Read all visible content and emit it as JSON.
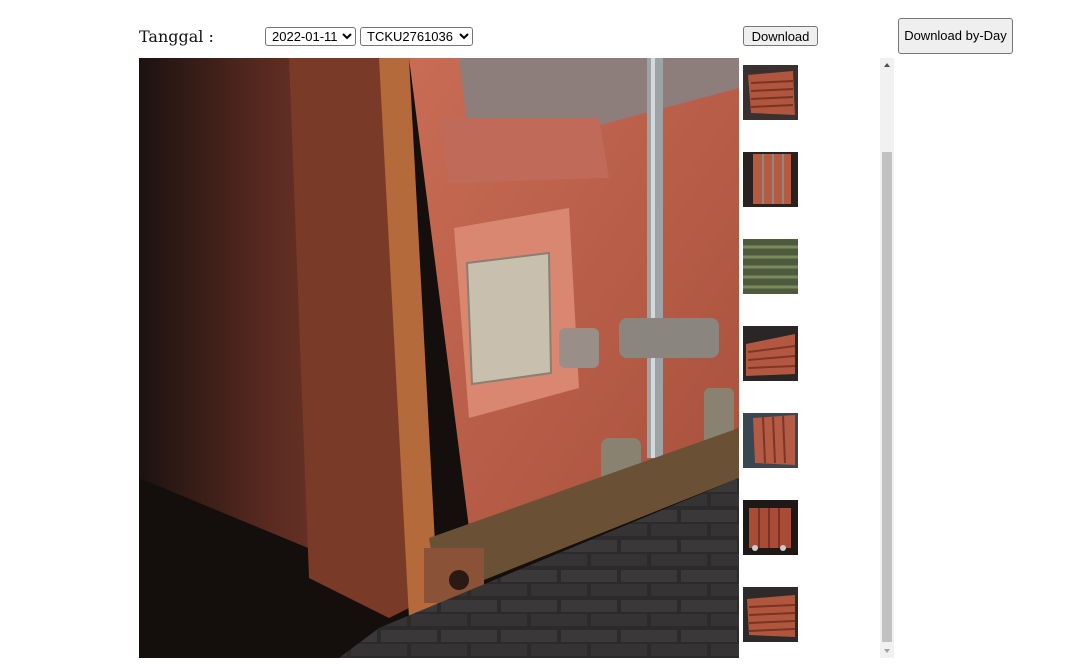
{
  "form": {
    "date_label": "Tanggal :",
    "date_value": "2022-01-11",
    "container_value": "TCKU2761036"
  },
  "buttons": {
    "download": "Download",
    "download_by_day": "Download by-Day"
  },
  "thumbnails": [
    "thumb-1",
    "thumb-2",
    "thumb-3",
    "thumb-4",
    "thumb-5",
    "thumb-6",
    "thumb-7"
  ],
  "colors": {
    "container_rust": "#b85a45",
    "container_dark": "#5a2a20",
    "pavement": "#2c2a2a"
  },
  "icons": {
    "scroll_up": "triangle-up-icon",
    "scroll_down": "triangle-down-icon",
    "select_arrow": "chevron-down-icon"
  }
}
